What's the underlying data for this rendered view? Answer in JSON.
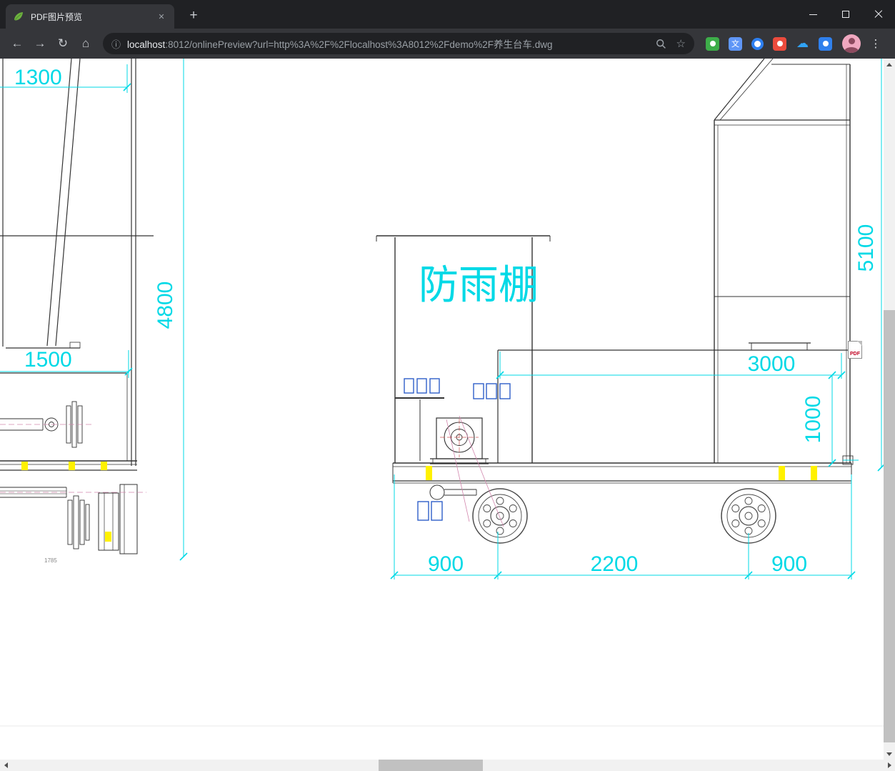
{
  "window": {
    "tab_title": "PDF图片预览"
  },
  "icons": {
    "back": "←",
    "forward": "→",
    "reload": "↻",
    "home": "⌂",
    "info": "ⓘ",
    "star": "☆",
    "menu": "⋮",
    "new_tab": "+",
    "tab_close": "✕",
    "cloud": "☁",
    "translate_glyph": "文"
  },
  "omnibox": {
    "host": "localhost",
    "rest": ":8012/onlinePreview?url=http%3A%2F%2Flocalhost%3A8012%2Fdemo%2F养生台车.dwg"
  },
  "drawing": {
    "shelter_label": "防雨棚",
    "dims": {
      "h1300": "1300",
      "v4800": "4800",
      "h1500": "1500",
      "v5100": "5100",
      "h3000": "3000",
      "v1000": "1000",
      "b900_left": "900",
      "b2200": "2200",
      "b900_right": "900",
      "note": "1785"
    },
    "colors": {
      "dimension_cyan": "#00d9e6",
      "line_black": "#333333",
      "highlight_yellow": "#fff100",
      "detail_blue": "#2f5fc9",
      "aux_magenta": "#d286ad"
    }
  },
  "badge": {
    "pdf": "PDF"
  }
}
